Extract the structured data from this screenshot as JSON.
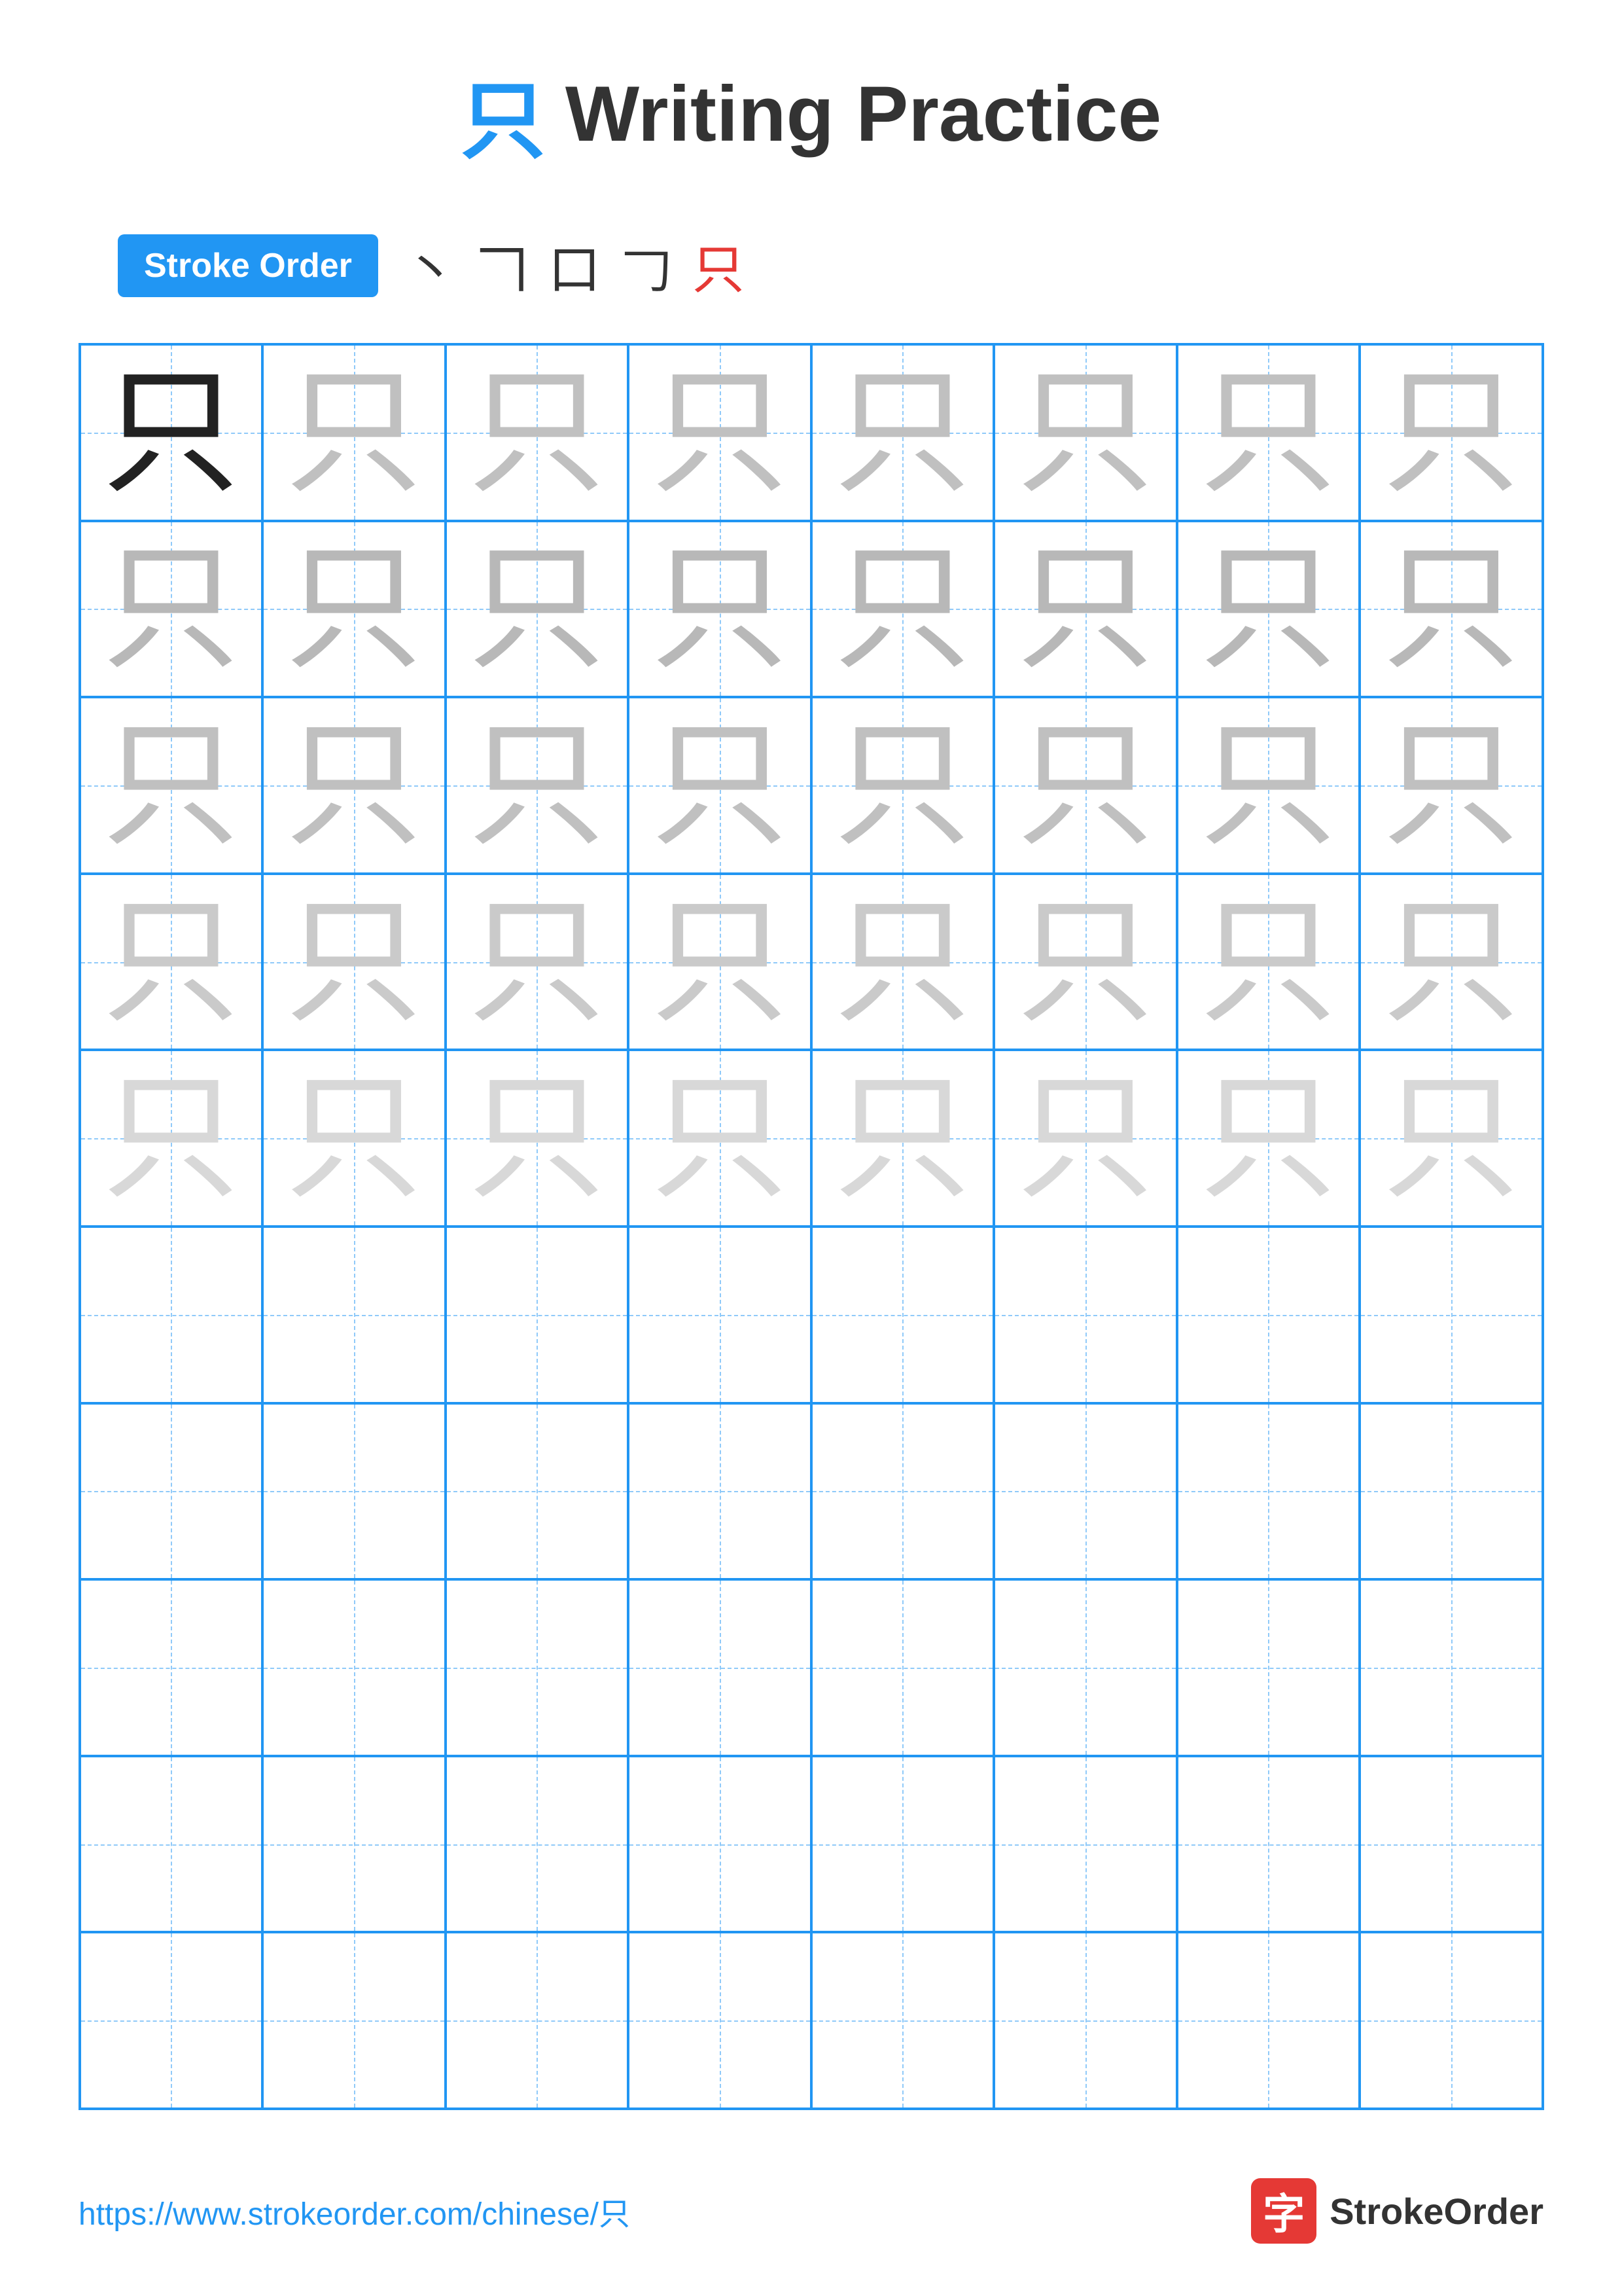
{
  "page": {
    "title": "Writing Practice",
    "title_char": "只",
    "stroke_order_label": "Stroke Order",
    "stroke_sequence": [
      "丶",
      "𠃍",
      "口",
      "𠃌",
      "只"
    ],
    "practice_char": "只",
    "grid_cols": 8,
    "grid_rows": 10,
    "filled_rows": 5,
    "footer_url": "https://www.strokeorder.com/chinese/只",
    "footer_logo_text": "StrokeOrder",
    "footer_logo_char": "字"
  }
}
